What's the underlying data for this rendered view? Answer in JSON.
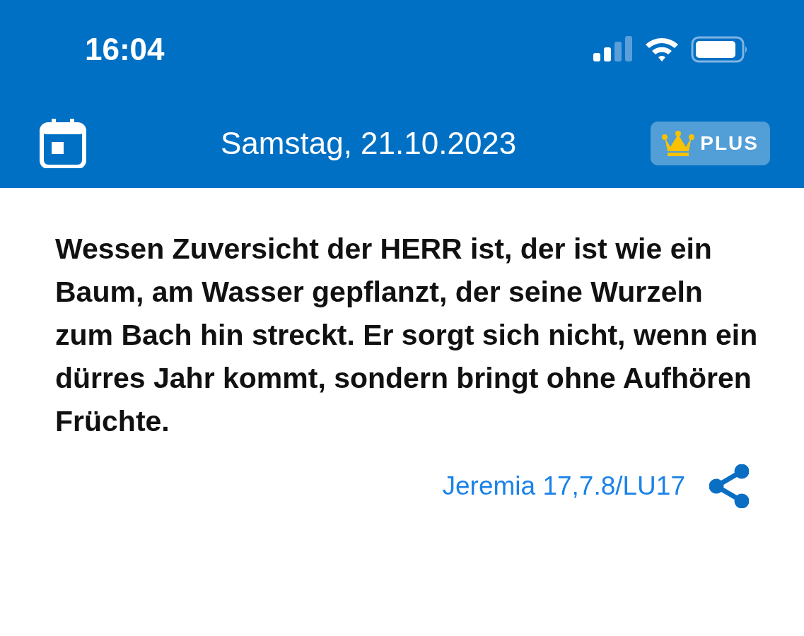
{
  "status_bar": {
    "time": "16:04"
  },
  "header": {
    "title": "Samstag, 21.10.2023",
    "badge": "PLUS"
  },
  "verse": {
    "text": "Wessen Zuversicht der HERR ist, der ist wie ein Baum, am Wasser gepflanzt, der seine Wurzeln zum Bach hin streckt. Er sorgt sich nicht, wenn ein dürres Jahr kommt, sondern bringt ohne Aufhören Früchte.",
    "reference": "Jeremia 17,7.8/LU17"
  }
}
